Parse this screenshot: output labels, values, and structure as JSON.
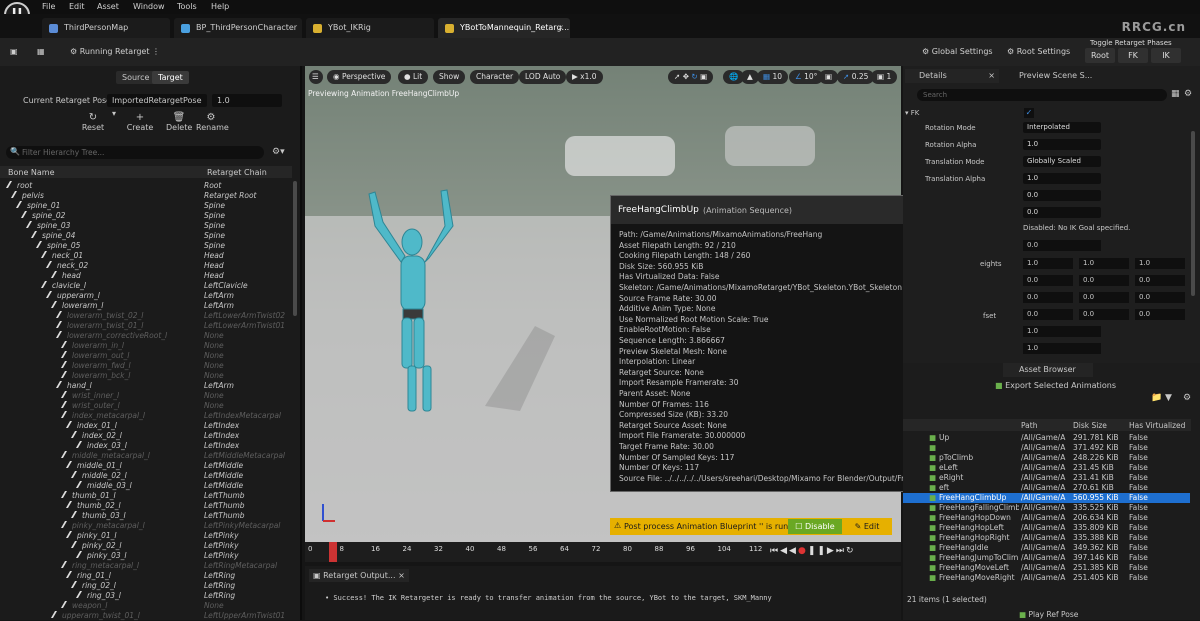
{
  "menubar": {
    "items": [
      "File",
      "Edit",
      "Asset",
      "Window",
      "Tools",
      "Help"
    ]
  },
  "tabs": [
    {
      "label": "ThirdPersonMap",
      "color": "#5b8cd6"
    },
    {
      "label": "BP_ThirdPersonCharacter",
      "color": "#4aa0e0"
    },
    {
      "label": "YBot_IKRig",
      "color": "#d9b030"
    },
    {
      "label": "YBotToMannequin_Retarg...",
      "color": "#d9b030"
    }
  ],
  "watermark": "RRCG.cn",
  "toolbar": {
    "running_retarget": "Running Retarget",
    "global_settings": "Global Settings",
    "root_settings": "Root Settings",
    "toggle_phases": "Toggle Retarget Phases",
    "phase_root": "Root",
    "phase_fk": "FK",
    "phase_ik": "IK"
  },
  "left": {
    "source": "Source",
    "target": "Target",
    "pose_label": "Current Retarget Pose:",
    "pose_value": "ImportedRetargetPose",
    "pose_num": "1.0",
    "reset": "Reset",
    "create": "Create",
    "delete": "Delete",
    "rename": "Rename",
    "filter_placeholder": "Filter Hierarchy Tree...",
    "col_bone": "Bone Name",
    "col_chain": "Retarget Chain",
    "rows": [
      {
        "bone": "root",
        "chain": "Root",
        "indent": 0,
        "dim": false
      },
      {
        "bone": "pelvis",
        "chain": "Retarget Root",
        "indent": 1,
        "dim": false
      },
      {
        "bone": "spine_01",
        "chain": "Spine",
        "indent": 2,
        "dim": false
      },
      {
        "bone": "spine_02",
        "chain": "Spine",
        "indent": 3,
        "dim": false
      },
      {
        "bone": "spine_03",
        "chain": "Spine",
        "indent": 4,
        "dim": false
      },
      {
        "bone": "spine_04",
        "chain": "Spine",
        "indent": 5,
        "dim": false
      },
      {
        "bone": "spine_05",
        "chain": "Spine",
        "indent": 6,
        "dim": false
      },
      {
        "bone": "neck_01",
        "chain": "Head",
        "indent": 7,
        "dim": false
      },
      {
        "bone": "neck_02",
        "chain": "Head",
        "indent": 8,
        "dim": false
      },
      {
        "bone": "head",
        "chain": "Head",
        "indent": 9,
        "dim": false
      },
      {
        "bone": "clavicle_l",
        "chain": "LeftClavicle",
        "indent": 7,
        "dim": false
      },
      {
        "bone": "upperarm_l",
        "chain": "LeftArm",
        "indent": 8,
        "dim": false
      },
      {
        "bone": "lowerarm_l",
        "chain": "LeftArm",
        "indent": 9,
        "dim": false
      },
      {
        "bone": "lowerarm_twist_02_l",
        "chain": "LeftLowerArmTwist02",
        "indent": 10,
        "dim": true
      },
      {
        "bone": "lowerarm_twist_01_l",
        "chain": "LeftLowerArmTwist01",
        "indent": 10,
        "dim": true
      },
      {
        "bone": "lowerarm_correctiveRoot_l",
        "chain": "None",
        "indent": 10,
        "dim": true
      },
      {
        "bone": "lowerarm_in_l",
        "chain": "None",
        "indent": 11,
        "dim": true
      },
      {
        "bone": "lowerarm_out_l",
        "chain": "None",
        "indent": 11,
        "dim": true
      },
      {
        "bone": "lowerarm_fwd_l",
        "chain": "None",
        "indent": 11,
        "dim": true
      },
      {
        "bone": "lowerarm_bck_l",
        "chain": "None",
        "indent": 11,
        "dim": true
      },
      {
        "bone": "hand_l",
        "chain": "LeftArm",
        "indent": 10,
        "dim": false
      },
      {
        "bone": "wrist_inner_l",
        "chain": "None",
        "indent": 11,
        "dim": true
      },
      {
        "bone": "wrist_outer_l",
        "chain": "None",
        "indent": 11,
        "dim": true
      },
      {
        "bone": "index_metacarpal_l",
        "chain": "LeftIndexMetacarpal",
        "indent": 11,
        "dim": true
      },
      {
        "bone": "index_01_l",
        "chain": "LeftIndex",
        "indent": 12,
        "dim": false
      },
      {
        "bone": "index_02_l",
        "chain": "LeftIndex",
        "indent": 13,
        "dim": false
      },
      {
        "bone": "index_03_l",
        "chain": "LeftIndex",
        "indent": 14,
        "dim": false
      },
      {
        "bone": "middle_metacarpal_l",
        "chain": "LeftMiddleMetacarpal",
        "indent": 11,
        "dim": true
      },
      {
        "bone": "middle_01_l",
        "chain": "LeftMiddle",
        "indent": 12,
        "dim": false
      },
      {
        "bone": "middle_02_l",
        "chain": "LeftMiddle",
        "indent": 13,
        "dim": false
      },
      {
        "bone": "middle_03_l",
        "chain": "LeftMiddle",
        "indent": 14,
        "dim": false
      },
      {
        "bone": "thumb_01_l",
        "chain": "LeftThumb",
        "indent": 11,
        "dim": false
      },
      {
        "bone": "thumb_02_l",
        "chain": "LeftThumb",
        "indent": 12,
        "dim": false
      },
      {
        "bone": "thumb_03_l",
        "chain": "LeftThumb",
        "indent": 13,
        "dim": false
      },
      {
        "bone": "pinky_metacarpal_l",
        "chain": "LeftPinkyMetacarpal",
        "indent": 11,
        "dim": true
      },
      {
        "bone": "pinky_01_l",
        "chain": "LeftPinky",
        "indent": 12,
        "dim": false
      },
      {
        "bone": "pinky_02_l",
        "chain": "LeftPinky",
        "indent": 13,
        "dim": false
      },
      {
        "bone": "pinky_03_l",
        "chain": "LeftPinky",
        "indent": 14,
        "dim": false
      },
      {
        "bone": "ring_metacarpal_l",
        "chain": "LeftRingMetacarpal",
        "indent": 11,
        "dim": true
      },
      {
        "bone": "ring_01_l",
        "chain": "LeftRing",
        "indent": 12,
        "dim": false
      },
      {
        "bone": "ring_02_l",
        "chain": "LeftRing",
        "indent": 13,
        "dim": false
      },
      {
        "bone": "ring_03_l",
        "chain": "LeftRing",
        "indent": 14,
        "dim": false
      },
      {
        "bone": "weapon_l",
        "chain": "None",
        "indent": 11,
        "dim": true
      },
      {
        "bone": "upperarm_twist_01_l",
        "chain": "LeftUpperArmTwist01",
        "indent": 9,
        "dim": true
      }
    ]
  },
  "viewport": {
    "perspective": "Perspective",
    "lit": "Lit",
    "show": "Show",
    "character": "Character",
    "lod": "LOD Auto",
    "speed": "x1.0",
    "grid": "10",
    "angle": "10°",
    "scale": "0.25",
    "cams": "1",
    "preview_text": "Previewing Animation FreeHangClimbUp"
  },
  "tooltip": {
    "title": "FreeHangClimbUp",
    "subtitle": "(Animation Sequence)",
    "lines": [
      "Path: /Game/Animations/MixamoAnimations/FreeHang",
      "Asset Filepath Length: 92 / 210",
      "Cooking Filepath Length: 148 / 260",
      "Disk Size: 560.955 KiB",
      "Has Virtualized Data: False",
      "Skeleton: /Game/Animations/MixamoRetarget/YBot_Skeleton.YBot_Skeleton",
      "Source Frame Rate: 30.00",
      "Additive Anim Type: None",
      "Use Normalized Root Motion Scale: True",
      "EnableRootMotion: False",
      "Sequence Length: 3.866667",
      "Preview Skeletal Mesh: None",
      "Interpolation: Linear",
      "Retarget Source: None",
      "Import Resample Framerate: 30",
      "Parent Asset: None",
      "Number Of Frames: 116",
      "Compressed Size (KB): 33.20",
      "Retarget Source Asset: None",
      "Import File Framerate: 30.000000",
      "Target Frame Rate: 30.00",
      "Number Of Sampled Keys: 117",
      "Number Of Keys: 117",
      "Source File: ../../../../../Users/sreehari/Desktop/Mixamo For Blender/Output/FreeHangClimbUp.fbx"
    ]
  },
  "blueprint_bar": {
    "text": "Post process Animation Blueprint '' is running.",
    "disable": "Disable",
    "edit": "Edit"
  },
  "timeline": {
    "ticks": [
      "0",
      "8",
      "16",
      "24",
      "32",
      "40",
      "48",
      "56",
      "64",
      "72",
      "80",
      "88",
      "96",
      "104",
      "112"
    ],
    "playhead": "6"
  },
  "output": {
    "tab": "Retarget Output...",
    "message": "• Success! The IK Retargeter is ready to transfer animation from the source, YBot to the target, SKM_Manny"
  },
  "details": {
    "tab": "Details",
    "tab2": "Preview Scene S...",
    "search_placeholder": "Search",
    "section": "FK",
    "rows": [
      {
        "label": "Rotation Mode",
        "value": "Interpolated"
      },
      {
        "label": "Rotation Alpha",
        "value": "1.0"
      },
      {
        "label": "Translation Mode",
        "value": "Globally Scaled"
      },
      {
        "label": "Translation Alpha",
        "value": "1.0"
      },
      {
        "label": "",
        "value": "0.0"
      },
      {
        "label": "",
        "value": "0.0"
      }
    ],
    "ik_note": "Disabled: No IK Goal specified.",
    "weights_label": "eights",
    "offset_label": "fset",
    "grid_vals": [
      "1.0",
      "1.0",
      "1.0",
      "0.0",
      "0.0",
      "0.0",
      "0.0",
      "0.0",
      "0.0",
      "0.0",
      "0.0",
      "0.0"
    ]
  },
  "assets": {
    "tab": "Asset Browser",
    "export": "Export Selected Animations",
    "col_path": "Path",
    "col_disk": "Disk Size",
    "col_virt": "Has Virtualized",
    "rows": [
      {
        "name": "Up",
        "path": "/All/Game/A",
        "size": "291.781 KiB",
        "virt": "False",
        "sel": false
      },
      {
        "name": "",
        "path": "/All/Game/A",
        "size": "371.492 KiB",
        "virt": "False",
        "sel": false
      },
      {
        "name": "pToClimb",
        "path": "/All/Game/A",
        "size": "248.226 KiB",
        "virt": "False",
        "sel": false
      },
      {
        "name": "eLeft",
        "path": "/All/Game/A",
        "size": "231.45 KiB",
        "virt": "False",
        "sel": false
      },
      {
        "name": "eRight",
        "path": "/All/Game/A",
        "size": "231.41 KiB",
        "virt": "False",
        "sel": false
      },
      {
        "name": "eft",
        "path": "/All/Game/A",
        "size": "270.61 KiB",
        "virt": "False",
        "sel": false
      },
      {
        "name": "FreeHangClimbUp",
        "path": "/All/Game/A",
        "size": "560.955 KiB",
        "virt": "False",
        "sel": true
      },
      {
        "name": "FreeHangFallingClimb",
        "path": "/All/Game/A",
        "size": "335.525 KiB",
        "virt": "False",
        "sel": false
      },
      {
        "name": "FreeHangHopDown",
        "path": "/All/Game/A",
        "size": "206.634 KiB",
        "virt": "False",
        "sel": false
      },
      {
        "name": "FreeHangHopLeft",
        "path": "/All/Game/A",
        "size": "335.809 KiB",
        "virt": "False",
        "sel": false
      },
      {
        "name": "FreeHangHopRight",
        "path": "/All/Game/A",
        "size": "335.388 KiB",
        "virt": "False",
        "sel": false
      },
      {
        "name": "FreeHangIdle",
        "path": "/All/Game/A",
        "size": "349.362 KiB",
        "virt": "False",
        "sel": false
      },
      {
        "name": "FreeHangJumpToClim",
        "path": "/All/Game/A",
        "size": "397.146 KiB",
        "virt": "False",
        "sel": false
      },
      {
        "name": "FreeHangMoveLeft",
        "path": "/All/Game/A",
        "size": "251.385 KiB",
        "virt": "False",
        "sel": false
      },
      {
        "name": "FreeHangMoveRight",
        "path": "/All/Game/A",
        "size": "251.405 KiB",
        "virt": "False",
        "sel": false
      }
    ],
    "count": "21 items (1 selected)",
    "play_ref": "Play Ref Pose"
  }
}
